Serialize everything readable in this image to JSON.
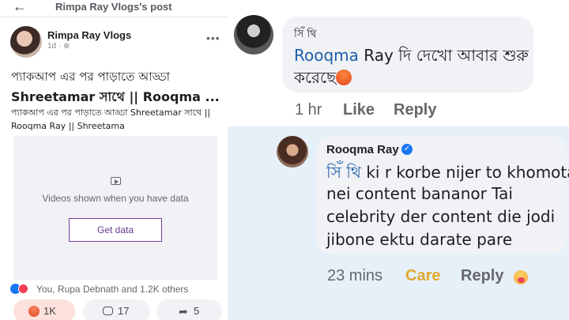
{
  "left_panel": {
    "header_title": "Rimpa Ray Vlogs's post",
    "page_name": "Rimpa Ray Vlogs",
    "post_meta": "1d · ⊕",
    "post_title_line1": "প্যাকআপ এর পর পাড়াতে আড্ডা",
    "post_title_line2": "Shreetamar সাথে || Rooqma ...",
    "post_description": "প্যাকআপ এর পর পাড়াতে আড্ডা Shreetamar সাথে || Rooqma Ray || Shreetama",
    "video_message": "Videos shown when you have data",
    "get_data_label": "Get data",
    "reactions_text": "You, Rupa Debnath and 1.2K others",
    "reaction_count": "1K",
    "comment_count": "17",
    "share_count": "5",
    "icons": {
      "back": "arrow-left-icon",
      "more": "more-horizontal-icon",
      "play": "video-icon",
      "reaction_like": "like-reaction-icon",
      "reaction_love": "love-reaction-icon",
      "angry": "angry-emoji-icon",
      "comment": "comment-icon",
      "share": "share-icon"
    }
  },
  "comment": {
    "author": "সিঁ থি",
    "mention": "Rooqma",
    "text_line1_rest": " Ray দি দেখো আবার শুরু",
    "text_line2": "করেছে",
    "time": "1 hr",
    "like_label": "Like",
    "reply_label": "Reply"
  },
  "reply": {
    "author": "Rooqma Ray",
    "mention": "সিঁ থি",
    "text_line1_rest": " ki r korbe nijer to khomota",
    "text_line2": "nei content bananor Tai",
    "text_line3": "celebrity der content die jodi",
    "text_line4": "jibone ektu darate pare",
    "time": "23 mins",
    "care_label": "Care",
    "reply_label": "Reply"
  },
  "colors": {
    "mention": "#1f5fa8",
    "care": "#e0a82e",
    "highlight_bg": "#e6f0f9",
    "bubble_bg": "#f0f2f5",
    "get_data_border": "#7a3fa0"
  }
}
